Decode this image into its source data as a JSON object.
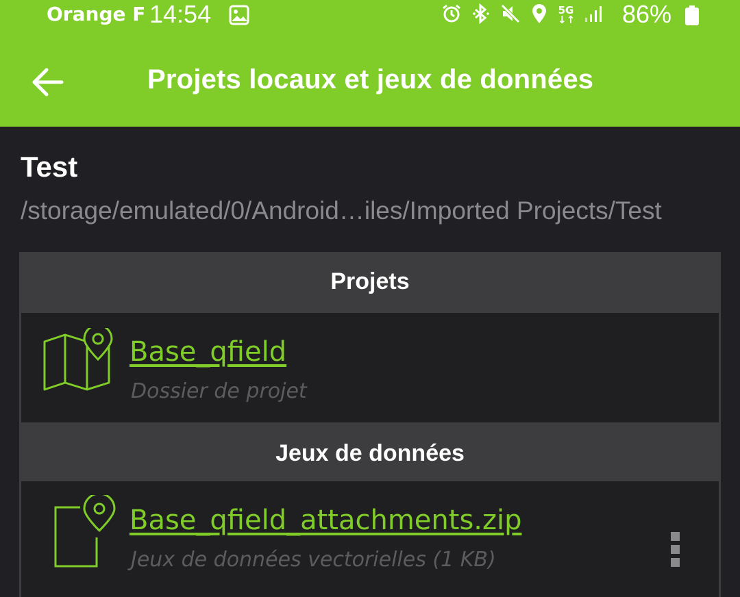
{
  "status_bar": {
    "carrier": "Orange F",
    "time": "14:54",
    "network": "5G",
    "battery": "86%",
    "icons": [
      "gallery-icon",
      "alarm-icon",
      "bluetooth-icon",
      "mute-icon",
      "location-icon",
      "network-5g-icon",
      "signal-icon",
      "battery-icon"
    ]
  },
  "toolbar": {
    "back_icon": "arrow-left-icon",
    "title": "Projets locaux et jeux de données"
  },
  "folder": {
    "name": "Test",
    "path": "/storage/emulated/0/Android…iles/Imported Projects/Test"
  },
  "sections": [
    {
      "header": "Projets",
      "items": [
        {
          "title": "Base_qfield",
          "subtitle": "Dossier de projet",
          "icon": "map-pin-icon"
        }
      ]
    },
    {
      "header": "Jeux de données",
      "items": [
        {
          "title": "Base_qfield_attachments.zip",
          "subtitle": "Jeux de données vectorielles (1 KB)",
          "icon": "file-pin-icon",
          "menu_icon": "more-vertical-icon"
        }
      ]
    }
  ],
  "colors": {
    "accent": "#80cc28",
    "background": "#202024",
    "section_header_bg": "#3d3d3f",
    "item_bg": "#1f1f21",
    "muted_text": "#8a8a8e"
  }
}
